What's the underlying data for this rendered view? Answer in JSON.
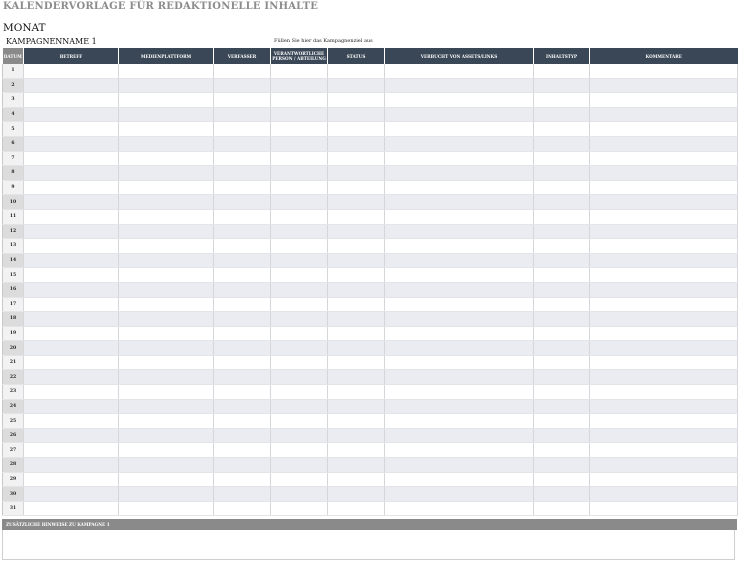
{
  "title": "KALENDERVORLAGE FÜR REDAKTIONELLE INHALTE",
  "month": "MONAT",
  "campaign": {
    "name": "KAMPAGNENNAME 1",
    "goal_placeholder": "Füllen Sie hier das Kampagnenziel aus"
  },
  "table": {
    "headers": [
      "DATUM",
      "BETREFF",
      "MEDIENPLATTFORM",
      "VERFASSER",
      "VERANTWORTLICHE PERSON / ABTEILUNG",
      "STATUS",
      "VERBUCHT VON ASSETS/LINKS",
      "INHALTSTYP",
      "KOMMENTARE"
    ],
    "days": [
      "1",
      "2",
      "3",
      "4",
      "5",
      "6",
      "7",
      "8",
      "9",
      "10",
      "11",
      "12",
      "13",
      "14",
      "15",
      "16",
      "17",
      "18",
      "19",
      "20",
      "21",
      "22",
      "23",
      "24",
      "25",
      "26",
      "27",
      "28",
      "29",
      "30",
      "31"
    ]
  },
  "notes": {
    "header": "ZUSÄTZLICHE HINWEISE ZU KAMPAGNE 1"
  }
}
